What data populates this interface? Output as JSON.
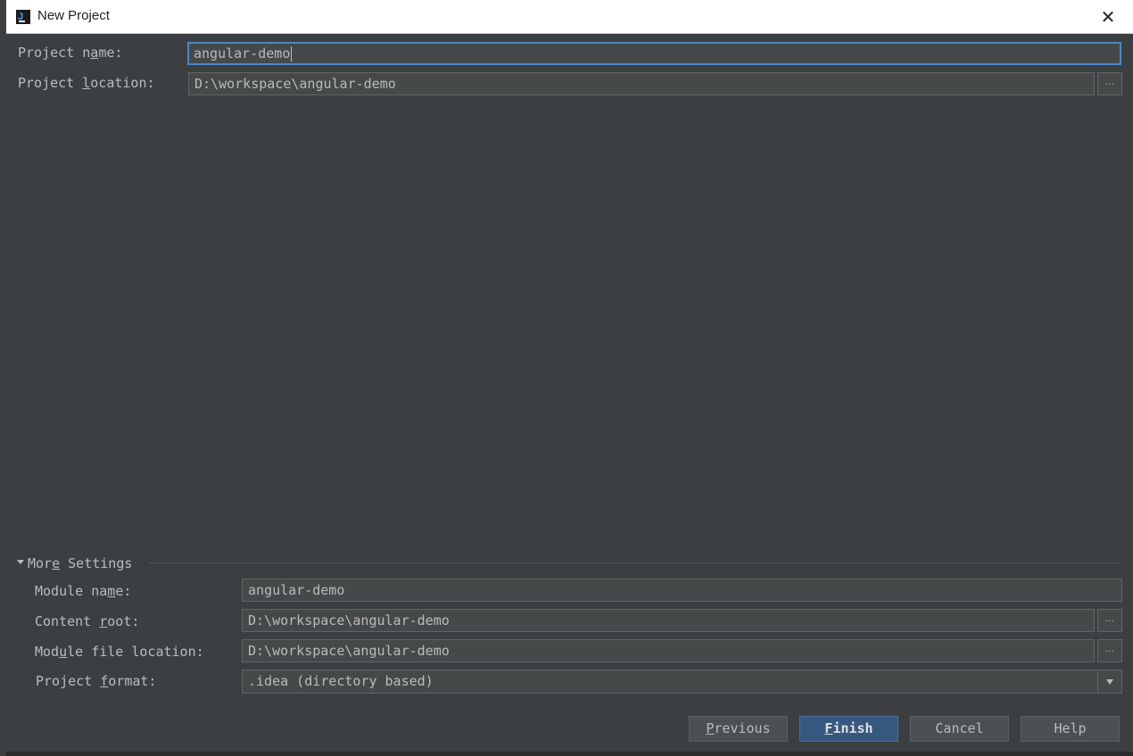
{
  "window": {
    "title": "New Project",
    "close_glyph": "✕",
    "app_icon_text": "J"
  },
  "form": {
    "project_name": {
      "label_a": "Project n",
      "label_u": "a",
      "label_b": "me:",
      "value": "angular-demo"
    },
    "project_location": {
      "label_a": "Project ",
      "label_u": "l",
      "label_b": "ocation:",
      "value": "D:\\workspace\\angular-demo",
      "browse": "…"
    }
  },
  "more_settings": {
    "header_a": "Mor",
    "header_u": "e",
    "header_b": " Settings",
    "module_name": {
      "label_a": "Module na",
      "label_u": "m",
      "label_b": "e:",
      "value": "angular-demo"
    },
    "content_root": {
      "label_a": "Content ",
      "label_u": "r",
      "label_b": "oot:",
      "value": "D:\\workspace\\angular-demo",
      "browse": "…"
    },
    "module_file_location": {
      "label_a": "Mod",
      "label_u": "u",
      "label_b": "le file location:",
      "value": "D:\\workspace\\angular-demo",
      "browse": "…"
    },
    "project_format": {
      "label_a": "Project ",
      "label_u": "f",
      "label_b": "ormat:",
      "value": ".idea (directory based)"
    }
  },
  "buttons": {
    "previous": {
      "u": "P",
      "rest": "revious"
    },
    "finish": {
      "u": "F",
      "rest": "inish"
    },
    "cancel": "Cancel",
    "help": "Help"
  },
  "colors": {
    "background": "#3c3f41",
    "field": "#45494a",
    "text": "#bbbbbb",
    "focus_border": "#4a88c7",
    "primary_button": "#365880"
  }
}
